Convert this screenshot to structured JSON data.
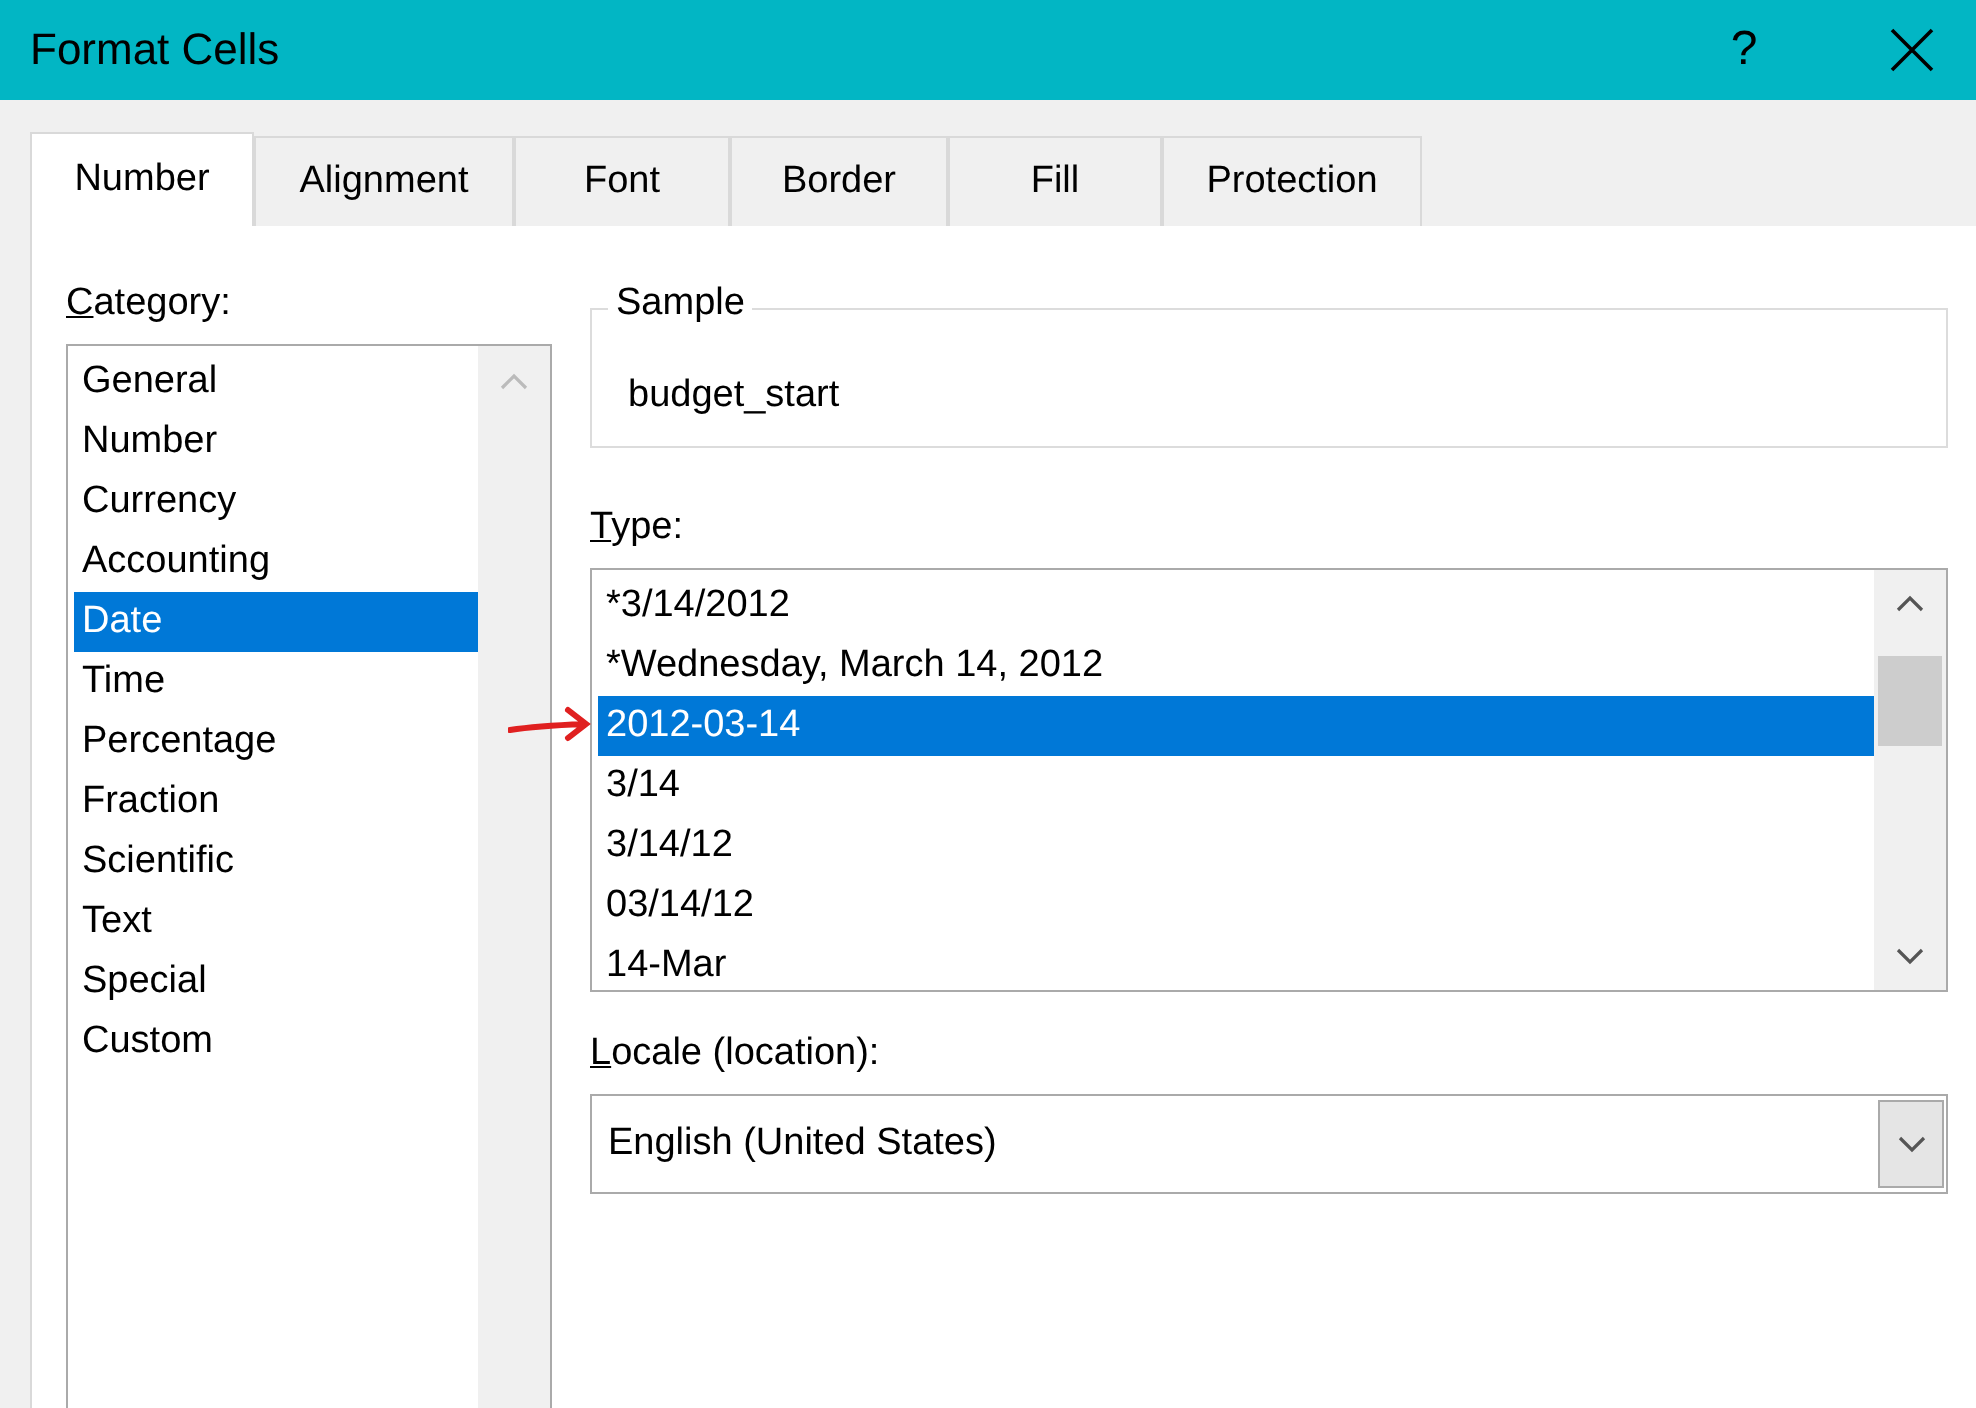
{
  "window": {
    "title": "Format Cells",
    "help_button": "?"
  },
  "tabs": [
    {
      "label": "Number",
      "selected": true
    },
    {
      "label": "Alignment",
      "selected": false
    },
    {
      "label": "Font",
      "selected": false
    },
    {
      "label": "Border",
      "selected": false
    },
    {
      "label": "Fill",
      "selected": false
    },
    {
      "label": "Protection",
      "selected": false
    }
  ],
  "category": {
    "label": "Category:",
    "items": [
      {
        "label": "General",
        "selected": false
      },
      {
        "label": "Number",
        "selected": false
      },
      {
        "label": "Currency",
        "selected": false
      },
      {
        "label": "Accounting",
        "selected": false
      },
      {
        "label": "Date",
        "selected": true
      },
      {
        "label": "Time",
        "selected": false
      },
      {
        "label": "Percentage",
        "selected": false
      },
      {
        "label": "Fraction",
        "selected": false
      },
      {
        "label": "Scientific",
        "selected": false
      },
      {
        "label": "Text",
        "selected": false
      },
      {
        "label": "Special",
        "selected": false
      },
      {
        "label": "Custom",
        "selected": false
      }
    ]
  },
  "sample": {
    "legend": "Sample",
    "value": "budget_start"
  },
  "type": {
    "label": "Type:",
    "items": [
      {
        "label": "*3/14/2012",
        "selected": false
      },
      {
        "label": "*Wednesday, March 14, 2012",
        "selected": false
      },
      {
        "label": "2012-03-14",
        "selected": true
      },
      {
        "label": "3/14",
        "selected": false
      },
      {
        "label": "3/14/12",
        "selected": false
      },
      {
        "label": "03/14/12",
        "selected": false
      },
      {
        "label": "14-Mar",
        "selected": false
      }
    ]
  },
  "locale": {
    "label": "Locale (location):",
    "value": "English (United States)"
  }
}
